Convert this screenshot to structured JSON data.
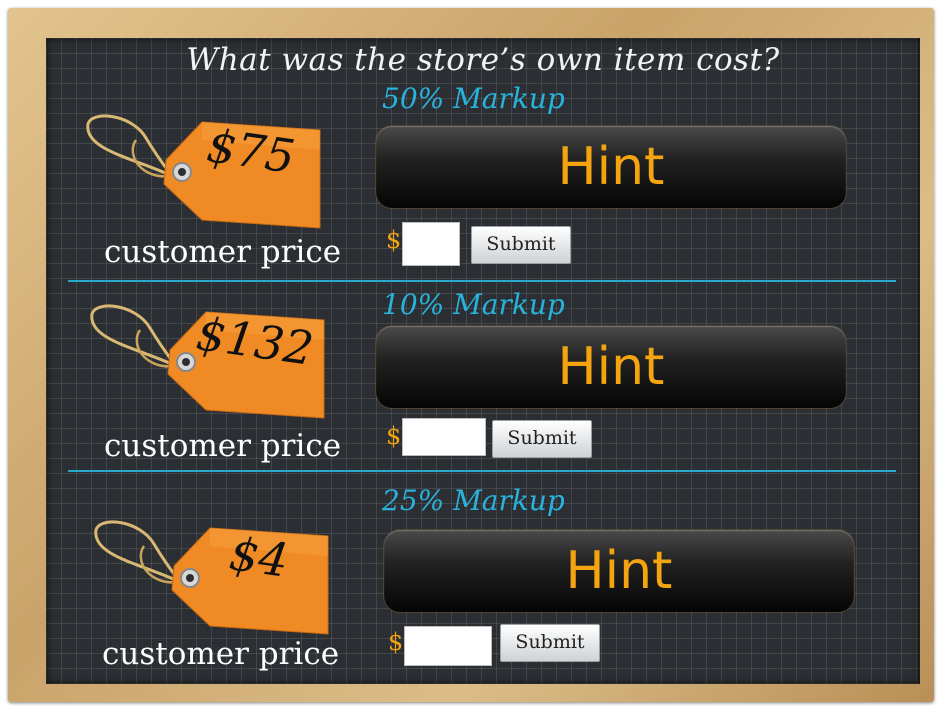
{
  "title": "What was the store’s own item cost?",
  "colors": {
    "board": "#2b2f33",
    "accent_blue": "#29b3dc",
    "hint_orange": "#f5a411",
    "tag_orange": "#f08a24",
    "frame_wood": "#d6b47c"
  },
  "problems": [
    {
      "markup": "50% Markup",
      "price": "$75",
      "caption": "customer price",
      "hint_label": "Hint",
      "currency": "$",
      "answer_value": "",
      "submit_label": "Submit"
    },
    {
      "markup": "10% Markup",
      "price": "$132",
      "caption": "customer price",
      "hint_label": "Hint",
      "currency": "$",
      "answer_value": "",
      "submit_label": "Submit"
    },
    {
      "markup": "25% Markup",
      "price": "$4",
      "caption": "customer price",
      "hint_label": "Hint",
      "currency": "$",
      "answer_value": "",
      "submit_label": "Submit"
    }
  ]
}
